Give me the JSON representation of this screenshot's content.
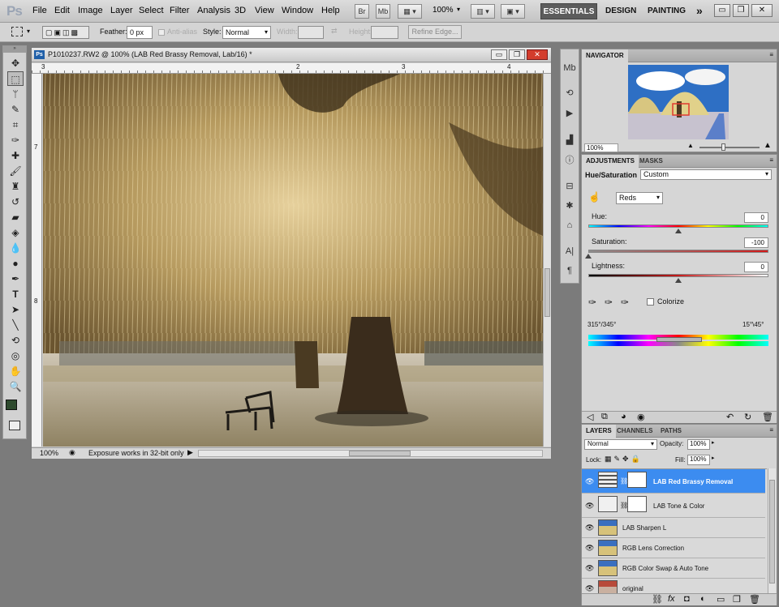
{
  "app": {
    "logo": "Ps"
  },
  "menu": [
    "File",
    "Edit",
    "Image",
    "Layer",
    "Select",
    "Filter",
    "Analysis",
    "3D",
    "View",
    "Window",
    "Help"
  ],
  "appbar": {
    "br": "Br",
    "mb": "Mb",
    "zoom": "100%"
  },
  "workspaces": {
    "essentials": "ESSENTIALS",
    "design": "DESIGN",
    "painting": "PAINTING",
    "more": "»"
  },
  "window_buttons": {
    "minimize": "▭",
    "restore": "❐",
    "close": "✕"
  },
  "options": {
    "feather_label": "Feather:",
    "feather_value": "0 px",
    "antialias": "Anti-alias",
    "style_label": "Style:",
    "style_value": "Normal",
    "width_label": "Width:",
    "height_label": "Height:",
    "refine": "Refine Edge..."
  },
  "document": {
    "title": "P1010237.RW2 @ 100% (LAB Red Brassy Removal, Lab/16) *",
    "zoom": "100%",
    "status": "Exposure works in 32-bit only",
    "ruler_top": [
      "3",
      "2",
      "3",
      "4"
    ],
    "ruler_left": [
      "7",
      "8"
    ]
  },
  "navigator": {
    "tab": "NAVIGATOR",
    "zoom": "100%"
  },
  "adjustments": {
    "tabs": [
      "ADJUSTMENTS",
      "MASKS"
    ],
    "title": "Hue/Saturation",
    "preset": "Custom",
    "channel": "Reds",
    "hue_label": "Hue:",
    "hue_value": "0",
    "saturation_label": "Saturation:",
    "saturation_value": "-100",
    "lightness_label": "Lightness:",
    "lightness_value": "0",
    "colorize": "Colorize",
    "range_left": "315°/345°",
    "range_right": "15°\\45°",
    "hue_pos": 0.5,
    "saturation_pos": 0.0,
    "lightness_pos": 0.5
  },
  "layers": {
    "tabs": [
      "LAYERS",
      "CHANNELS",
      "PATHS"
    ],
    "blend": "Normal",
    "opacity_label": "Opacity:",
    "opacity": "100%",
    "lock_label": "Lock:",
    "fill_label": "Fill:",
    "fill": "100%",
    "items": [
      {
        "name": "LAB Red Brassy Removal",
        "selected": true
      },
      {
        "name": "LAB Tone & Color",
        "selected": false
      },
      {
        "name": "LAB Sharpen L",
        "selected": false
      },
      {
        "name": "RGB Lens Correction",
        "selected": false
      },
      {
        "name": "RGB Color Swap & Auto Tone",
        "selected": false
      },
      {
        "name": "original",
        "selected": false
      }
    ]
  },
  "colors": {
    "selection": "#3c8cf0",
    "sepia": "#b59a62",
    "foreground": "#2e4a2e"
  }
}
